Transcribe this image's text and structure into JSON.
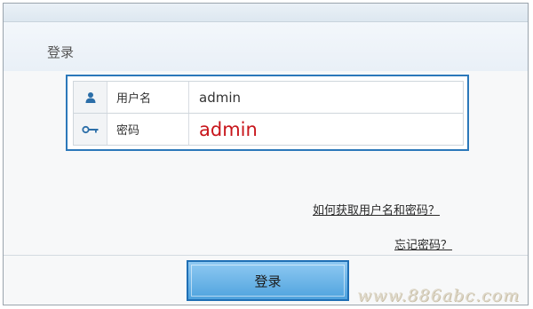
{
  "dialog": {
    "title": "登录"
  },
  "form": {
    "username": {
      "label": "用户名",
      "value": "admin",
      "icon": "user-icon"
    },
    "password": {
      "label": "密码",
      "value": "admin",
      "icon": "key-icon"
    }
  },
  "links": {
    "get_credentials": "如何获取用户名和密码？",
    "forgot_password": "忘记密码？"
  },
  "buttons": {
    "login": "登录"
  },
  "watermark": "www.886abc.com",
  "colors": {
    "accent": "#2b78ba",
    "password_text": "#c8151b"
  }
}
